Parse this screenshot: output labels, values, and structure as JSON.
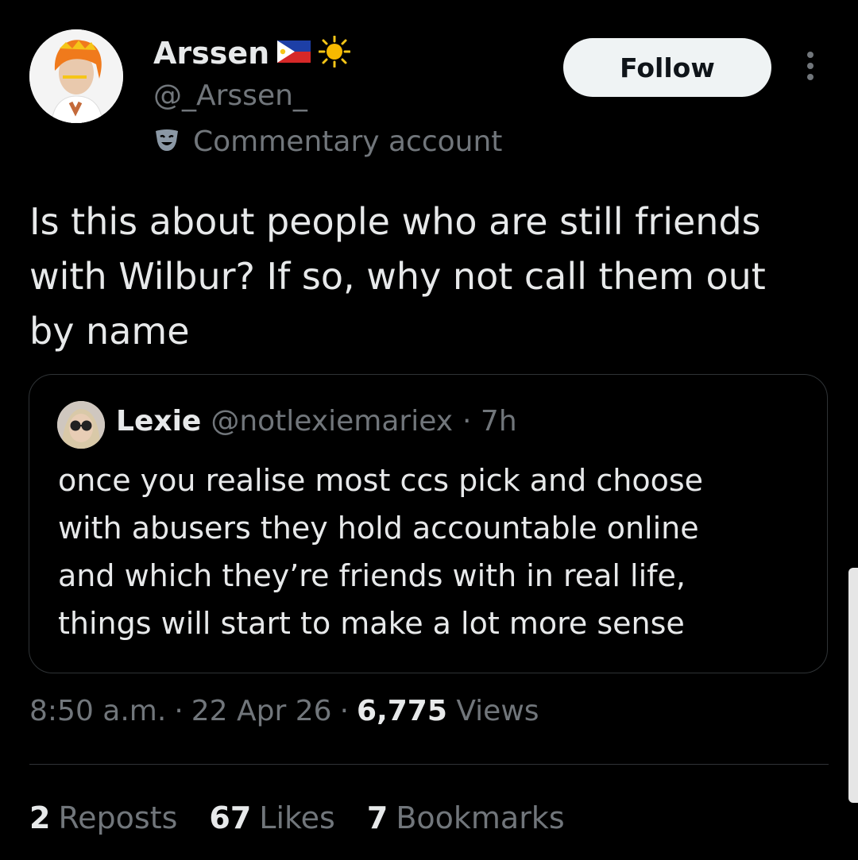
{
  "author": {
    "name": "Arssen",
    "flag_emoji": "🇵🇭",
    "extra_emoji": "☀",
    "handle": "@_Arssen_",
    "label_icon": "theater-masks-icon",
    "label": "Commentary account"
  },
  "follow_label": "Follow",
  "tweet_text": "Is this about people who are still friends\nwith Wilbur? If so, why not call them out\nby name",
  "quote": {
    "name": "Lexie",
    "handle": "@notlexiemariex",
    "time": "· 7h",
    "text": "once you realise most ccs pick and choose\nwith abusers they hold accountable  online\nand which they’re friends with in real life,\nthings will start to make a lot more sense"
  },
  "meta": {
    "time": "8:50 a.m.",
    "date": "22 Apr 26",
    "views_count": "6,775",
    "views_label": "Views"
  },
  "stats": {
    "reposts_count": "2",
    "reposts_label": "Reposts",
    "likes_count": "67",
    "likes_label": "Likes",
    "bookmarks_count": "7",
    "bookmarks_label": "Bookmarks"
  }
}
